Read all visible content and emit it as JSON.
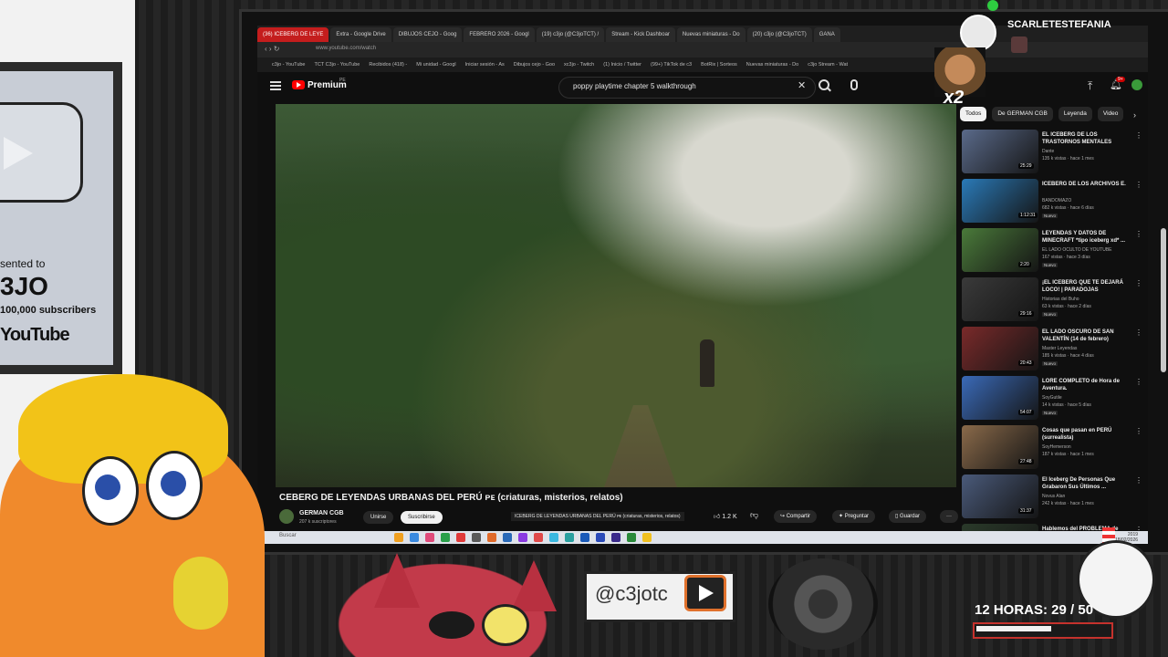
{
  "browser": {
    "tabs": [
      {
        "label": "(36) ICEBERG DE LEYE",
        "active": true
      },
      {
        "label": "Extra - Google Drive",
        "active": false
      },
      {
        "label": "DIBUJOS CEJO - Goog",
        "active": false
      },
      {
        "label": "FEBRERO 2026 - Googl",
        "active": false
      },
      {
        "label": "(19) c3jo (@C3joTCT) /",
        "active": false
      },
      {
        "label": "Stream - Kick Dashboar",
        "active": false
      },
      {
        "label": "Nuevas miniaturas - Do",
        "active": false
      },
      {
        "label": "(20) c3jo (@C3joTCT)",
        "active": false
      },
      {
        "label": "GANA",
        "active": false
      }
    ],
    "url": "www.youtube.com/watch",
    "bookmarks": [
      "c3jo - YouTube",
      "TCT C3jo - YouTube",
      "Recibidos (418) -",
      "Mi unidad - Googl",
      "Iniciar sesión - As",
      "Dibujos cejo - Goo",
      "xc3jo - Twitch",
      "(1) Inicio / Twitter",
      "(99+) TikTok de c3",
      "BotRix | Sorteos",
      "Nuevas miniaturas - Do",
      "c3jo Stream - Wat"
    ]
  },
  "youtube": {
    "brand": "Premium",
    "country": "PE",
    "search_query": "poppy playtime chapter 5 walkthrough",
    "notification_badge": "9+",
    "video": {
      "title": "ICEBERG DE LEYENDAS URBANAS DEL PERÚ 🇵🇪 (criaturas, misterios, relatos)",
      "title_visible": "CEBERG DE LEYENDAS URBANAS DEL PERÚ ᴘᴇ (criaturas, misterios, relatos)",
      "tooltip": "ICEBERG DE LEYENDAS URBANAS DEL PERÚ ᴘᴇ (criaturas, misterios, relatos)",
      "channel": "GERMAN CGB",
      "subscribers": "207 k suscriptores",
      "join_label": "Unirse",
      "subscribe_label": "Suscribirse",
      "likes": "1.2 K",
      "share_label": "Compartir",
      "ask_label": "Preguntar",
      "save_label": "Guardar",
      "more_label": "···"
    },
    "chips": [
      {
        "label": "Todos",
        "active": true
      },
      {
        "label": "De GERMAN CGB",
        "active": false
      },
      {
        "label": "Leyenda",
        "active": false
      },
      {
        "label": "Video",
        "active": false
      }
    ],
    "recommendations": [
      {
        "title": "EL ICEBERG DE LOS TRASTORNOS MENTALES",
        "channel": "Dante",
        "meta": "135 k vistas · hace 1 mes",
        "duration": "25:29",
        "new": "",
        "color": "#5a6a8a"
      },
      {
        "title": "ICEBERG DE LOS ARCHIVOS E.",
        "channel": "BANDOMAZO",
        "meta": "682 k vistas · hace 6 días",
        "duration": "1:12:31",
        "new": "Nuevo",
        "color": "#2a7ab8"
      },
      {
        "title": "LEYENDAS Y DATOS DE MINECRAFT *tipo iceberg xd* ...",
        "channel": "EL LADO OCULTO DE YOUTUBE",
        "meta": "167 vistas · hace 3 días",
        "duration": "2:20",
        "new": "Nuevo",
        "color": "#4a7a3a"
      },
      {
        "title": "¡EL ICEBERG QUE TE DEJARÁ LOCO! | PARADOJAS",
        "channel": "Historias del Buho",
        "meta": "63 k vistas · hace 2 días",
        "duration": "29:16",
        "new": "Nuevo",
        "color": "#3a3a3a"
      },
      {
        "title": "EL LADO OSCURO DE SAN VALENTÍN (14 de febrero)",
        "channel": "Master Leyendas",
        "meta": "185 k vistas · hace 4 días",
        "duration": "20:43",
        "new": "Nuevo",
        "color": "#7a2a2a"
      },
      {
        "title": "LORE COMPLETO de Hora de Aventura.",
        "channel": "SoyGutile",
        "meta": "14 k vistas · hace 5 días",
        "duration": "54:07",
        "new": "Nuevo",
        "color": "#3a6ab8"
      },
      {
        "title": "Cosas que pasan en PERÚ (surrealista)",
        "channel": "SoyHemerson",
        "meta": "187 k vistas · hace 1 mes",
        "duration": "27:48",
        "new": "",
        "color": "#8a6a4a"
      },
      {
        "title": "El Iceberg De Personas Que Grabaron Sus Últimos ...",
        "channel": "Novus Alan",
        "meta": "242 k vistas · hace 1 mes",
        "duration": "31:37",
        "new": "",
        "color": "#4a5a7a"
      },
      {
        "title": "Hablemos del PROBLEMA de SILKSO",
        "channel": "",
        "meta": "",
        "duration": "",
        "new": "",
        "color": "#2a3a2a"
      }
    ]
  },
  "taskbar": {
    "search_label": "Buscar",
    "clock_time": "2019",
    "clock_date": "18/02/2026",
    "icon_colors": [
      "#f0a020",
      "#3a8ae0",
      "#e04a7a",
      "#2aa04a",
      "#e03a3a",
      "#5a5a5a",
      "#e06a2a",
      "#2a6ab8",
      "#8a3ae0",
      "#e04a4a",
      "#3ab8e0",
      "#2aa0a0",
      "#1a5ab8",
      "#2a4ab8",
      "#3a2a8a",
      "#2a8a3a",
      "#f0c020"
    ]
  },
  "plaque": {
    "presented": "sented to",
    "name": "3JO",
    "subs": "100,000 subscribers",
    "yt": "YouTube"
  },
  "stream": {
    "streamer_name": "SCARLETESTEFANIA",
    "multiplier": "x2",
    "handle": "@c3jotc",
    "timer_text": "12 HORAS:   29 / 50",
    "timer_progress": 0.58
  }
}
